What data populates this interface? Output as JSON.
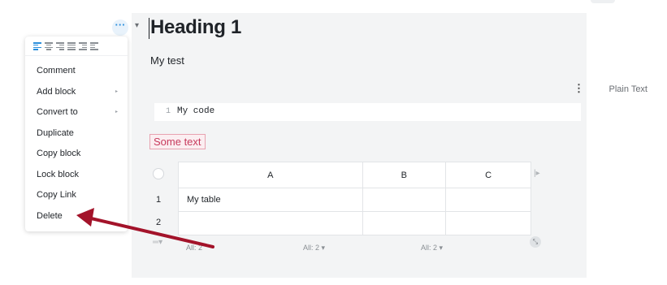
{
  "editor": {
    "heading": "Heading 1",
    "paragraph": "My test",
    "more_glyph": "···",
    "caret_glyph": "▾"
  },
  "code_block": {
    "language": "Plain Text",
    "menu_glyph": "⋮",
    "line_number": "1",
    "code": "My code"
  },
  "highlight_text": "Some text",
  "table": {
    "columns": [
      "A",
      "B",
      "C"
    ],
    "row_numbers": [
      "1",
      "2"
    ],
    "rows": [
      [
        "My table",
        "",
        ""
      ],
      [
        "",
        "",
        ""
      ]
    ],
    "summaries": [
      "All: 2",
      "All: 2",
      "All: 2"
    ],
    "summary_caret": "▾",
    "add_column_glyph": "|▸",
    "add_row_glyph": "═▾",
    "resize_glyph": "⤡"
  },
  "context_menu": {
    "items": [
      {
        "label": "Comment",
        "submenu": false
      },
      {
        "label": "Add block",
        "submenu": true
      },
      {
        "label": "Convert to",
        "submenu": true
      },
      {
        "label": "Duplicate",
        "submenu": false
      },
      {
        "label": "Copy block",
        "submenu": false
      },
      {
        "label": "Lock block",
        "submenu": false
      },
      {
        "label": "Copy Link",
        "submenu": false
      },
      {
        "label": "Delete",
        "submenu": false
      }
    ],
    "submenu_glyph": "▸",
    "align_icons": [
      "align-left-icon",
      "align-center-icon",
      "align-right-icon",
      "align-justify-icon",
      "indent-icon",
      "outdent-icon"
    ]
  },
  "colors": {
    "accent": "#2b8fdc",
    "annotation_arrow": "#a3132a",
    "tag_text": "#c73a5c"
  }
}
